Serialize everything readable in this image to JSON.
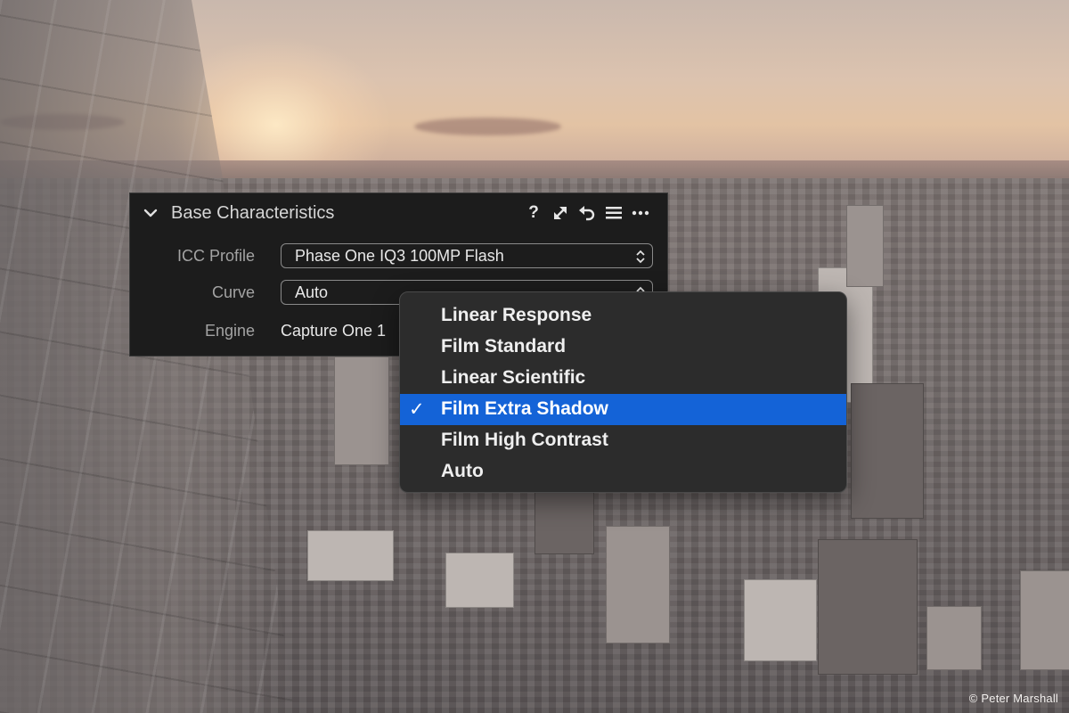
{
  "panel": {
    "title": "Base Characteristics",
    "help_symbol": "?",
    "rows": {
      "icc_profile": {
        "label": "ICC Profile",
        "value": "Phase One IQ3 100MP Flash"
      },
      "curve": {
        "label": "Curve",
        "value": "Auto"
      },
      "engine": {
        "label": "Engine",
        "value": "Capture One 1"
      }
    },
    "tool_icons": [
      "help-icon",
      "expand-icon",
      "reset-icon",
      "preset-list-icon",
      "more-icon"
    ]
  },
  "curve_menu": {
    "check_symbol": "✓",
    "selected_index": 3,
    "items": [
      "Linear Response",
      "Film Standard",
      "Linear Scientific",
      "Film Extra Shadow",
      "Film High Contrast",
      "Auto"
    ],
    "selection_color": "#1463d7"
  },
  "credit": "© Peter Marshall"
}
